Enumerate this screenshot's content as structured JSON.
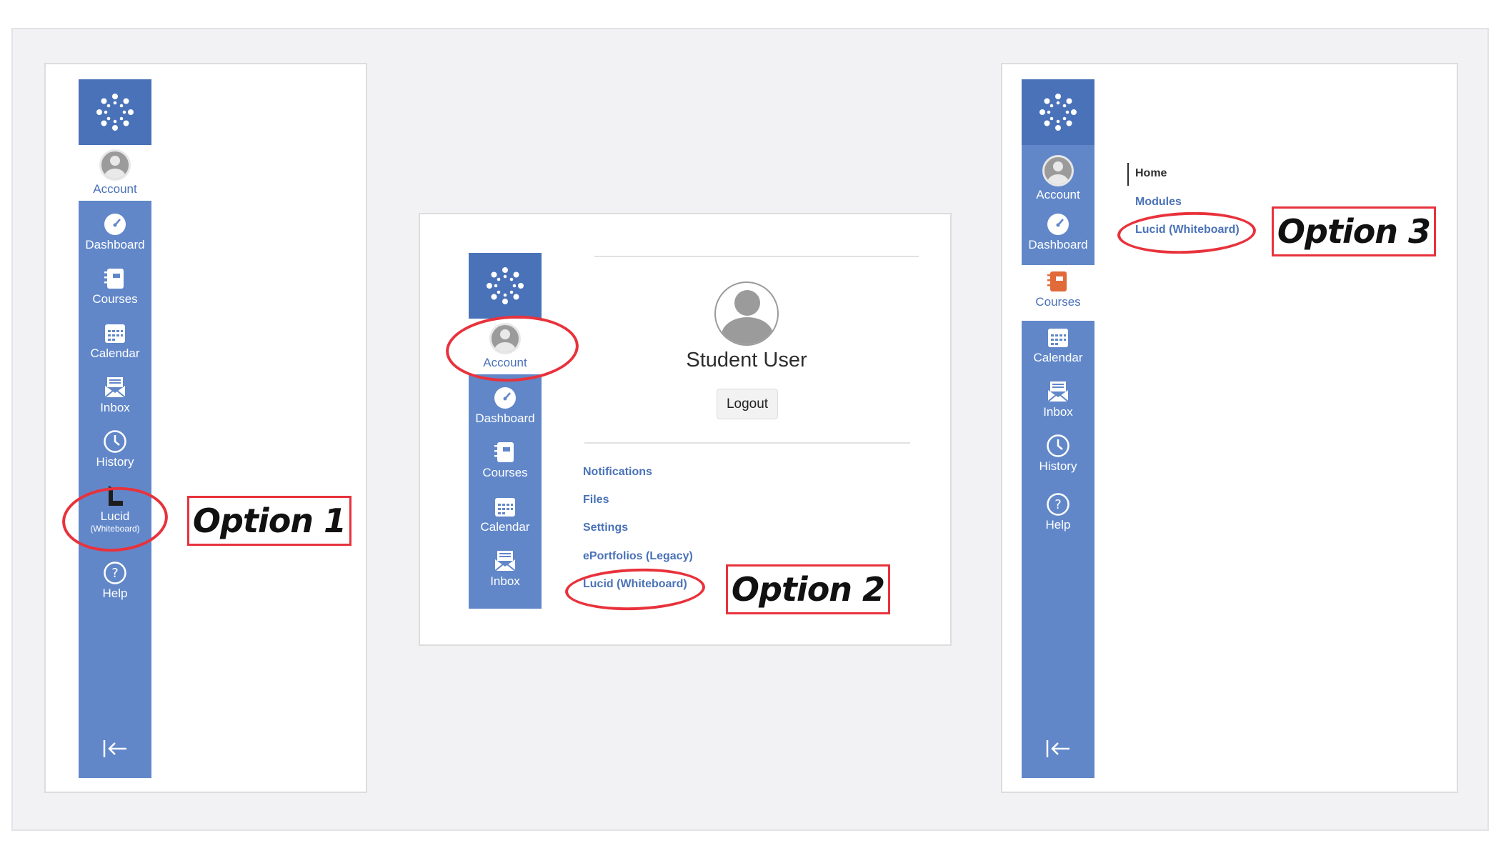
{
  "nav_items": {
    "account": "Account",
    "dashboard": "Dashboard",
    "courses": "Courses",
    "calendar": "Calendar",
    "inbox": "Inbox",
    "history": "History",
    "lucid": "Lucid",
    "lucid_sub": "(Whiteboard)",
    "help": "Help"
  },
  "options": {
    "option1": "Option 1",
    "option2": "Option 2",
    "option3": "Option 3"
  },
  "account_tray": {
    "user_name": "Student User",
    "logout_label": "Logout",
    "links": [
      "Notifications",
      "Files",
      "Settings",
      "ePortfolios (Legacy)",
      "Lucid (Whiteboard)"
    ]
  },
  "course_nav": {
    "items": [
      "Home",
      "Modules",
      "Lucid (Whiteboard)"
    ]
  },
  "colors": {
    "nav_bg": "#6187c9",
    "nav_logo_bg": "#4a72b8",
    "highlight_red": "#e8323c",
    "link_blue": "#4a72b8",
    "courses_icon_orange": "#e06a3a"
  },
  "icons": [
    "canvas-logo-icon",
    "avatar-icon",
    "dashboard-icon",
    "courses-icon",
    "calendar-icon",
    "inbox-icon",
    "history-icon",
    "lucid-icon",
    "help-icon",
    "collapse-icon"
  ]
}
